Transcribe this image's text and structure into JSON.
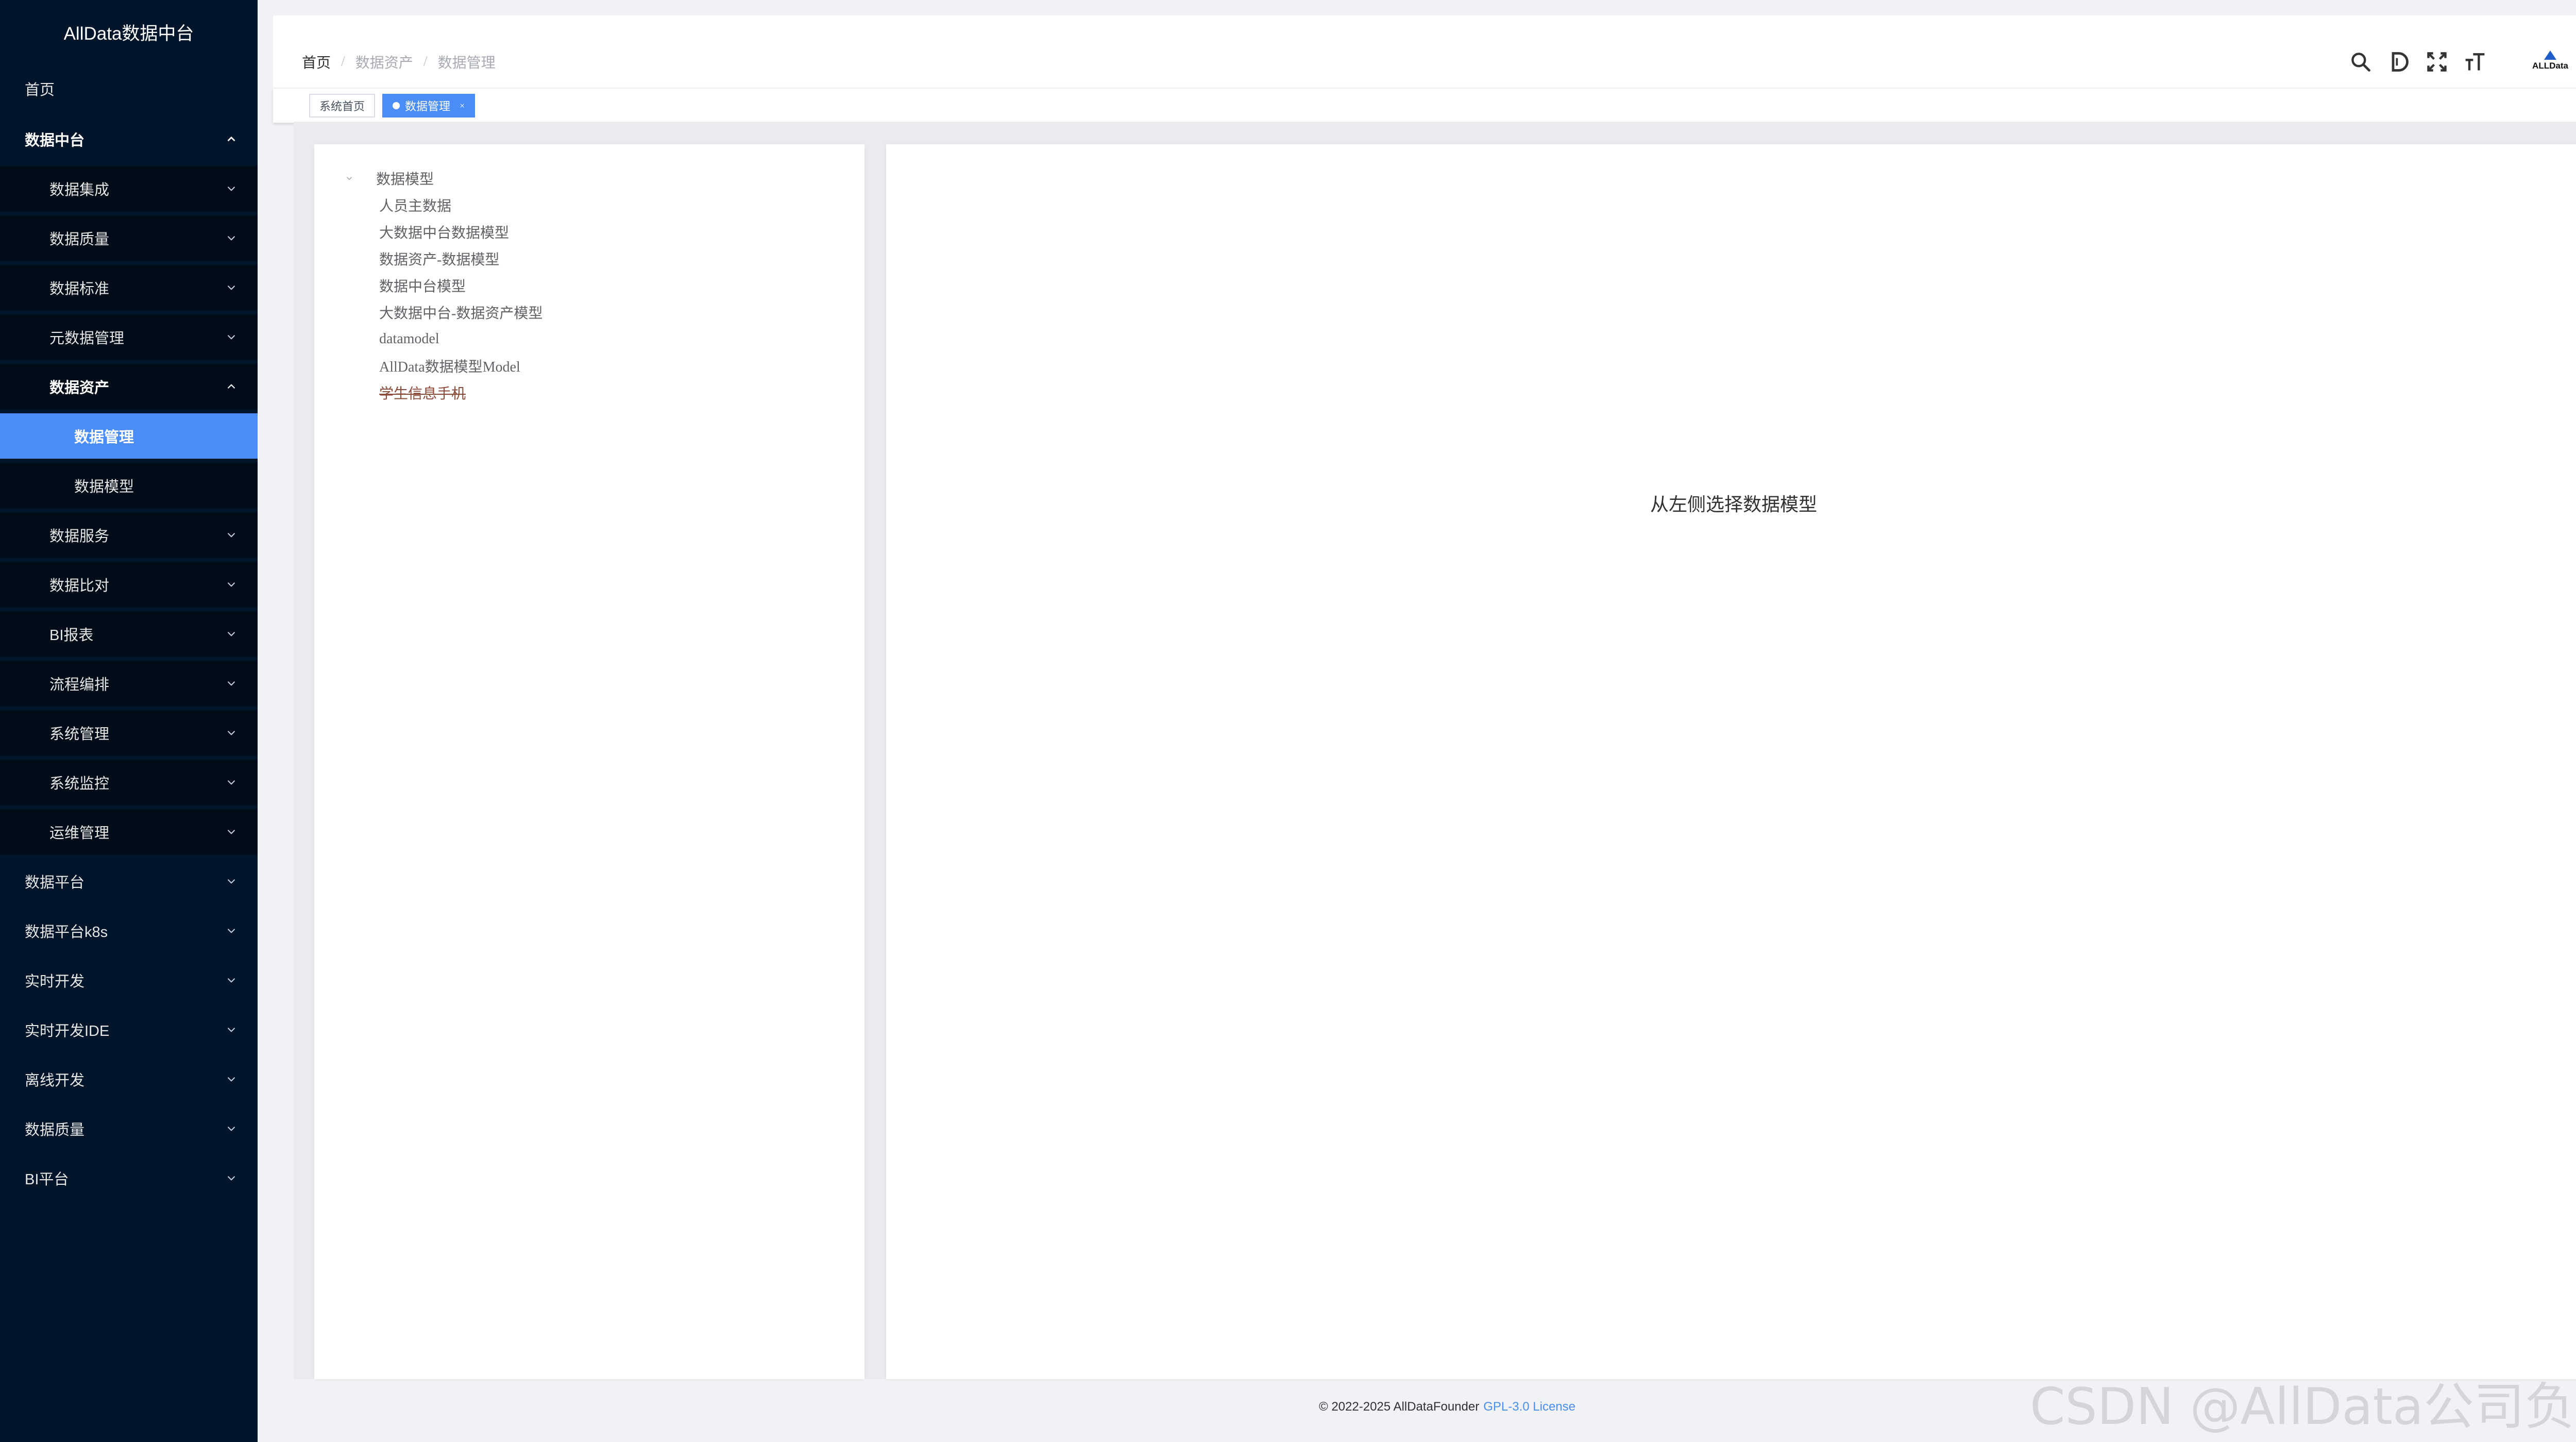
{
  "app": {
    "title": "AllData数据中台"
  },
  "sidebar": {
    "items": [
      {
        "label": "首页"
      },
      {
        "label": "数据中台"
      },
      {
        "label": "数据集成"
      },
      {
        "label": "数据质量"
      },
      {
        "label": "数据标准"
      },
      {
        "label": "元数据管理"
      },
      {
        "label": "数据资产"
      },
      {
        "label": "数据管理"
      },
      {
        "label": "数据模型"
      },
      {
        "label": "数据服务"
      },
      {
        "label": "数据比对"
      },
      {
        "label": "BI报表"
      },
      {
        "label": "流程编排"
      },
      {
        "label": "系统管理"
      },
      {
        "label": "系统监控"
      },
      {
        "label": "运维管理"
      },
      {
        "label": "数据平台"
      },
      {
        "label": "数据平台k8s"
      },
      {
        "label": "实时开发"
      },
      {
        "label": "实时开发IDE"
      },
      {
        "label": "离线开发"
      },
      {
        "label": "数据质量"
      },
      {
        "label": "BI平台"
      }
    ]
  },
  "header": {
    "breadcrumb": [
      "首页",
      "数据资产",
      "数据管理"
    ],
    "breadcrumb_sep": "/",
    "avatar_text": "ALLData"
  },
  "tags": [
    {
      "label": "系统首页"
    },
    {
      "label": "数据管理",
      "close": "×"
    }
  ],
  "tree": {
    "root": "数据模型",
    "children": [
      "人员主数据",
      "大数据中台数据模型",
      "数据资产-数据模型",
      "数据中台模型",
      "大数据中台-数据资产模型",
      "datamodel",
      "AllData数据模型Model",
      "学生信息手机"
    ]
  },
  "main": {
    "placeholder": "从左侧选择数据模型"
  },
  "footer": {
    "copyright": "© 2022-2025 AllDataFounder",
    "license": "GPL-3.0 License"
  },
  "watermark": "CSDN @AllData公司负责人",
  "colors": {
    "sidebar_bg": "#001529",
    "accent": "#4a8df6"
  }
}
